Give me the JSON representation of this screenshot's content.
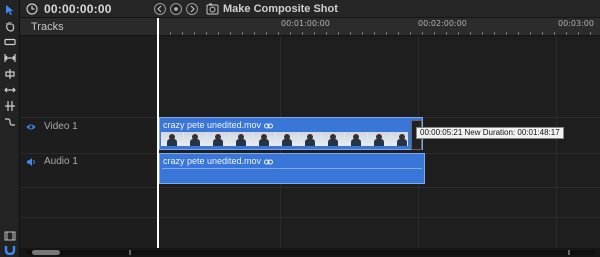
{
  "header": {
    "timecode": "00:00:00:00",
    "composite_label": "Make Composite Shot"
  },
  "tracks_header": {
    "label": "Tracks"
  },
  "ruler": {
    "labels": [
      "00:01:00:00",
      "00:02:00:00",
      "00:03:00"
    ]
  },
  "tracks": [
    {
      "name": "Video 1",
      "icon": "eye-icon"
    },
    {
      "name": "Audio 1",
      "icon": "speaker-icon"
    }
  ],
  "clips": {
    "video": {
      "title": "crazy pete unedited.mov"
    },
    "audio": {
      "title": "crazy pete unedited.mov"
    }
  },
  "tooltip": {
    "text": "00:00:05:21 New Duration: 00:01:48:17"
  },
  "toolbar": {
    "tools": [
      "select-arrow-icon",
      "hand-icon",
      "razor-icon",
      "ripple-icon",
      "roll-icon",
      "slip-icon",
      "slide-icon",
      "rate-stretch-icon"
    ],
    "bottom": [
      "film-icon",
      "magnet-icon"
    ]
  },
  "colors": {
    "clip_blue": "#3a75d8",
    "accent_blue": "#3d8bf2",
    "background": "#1c1c1c"
  }
}
